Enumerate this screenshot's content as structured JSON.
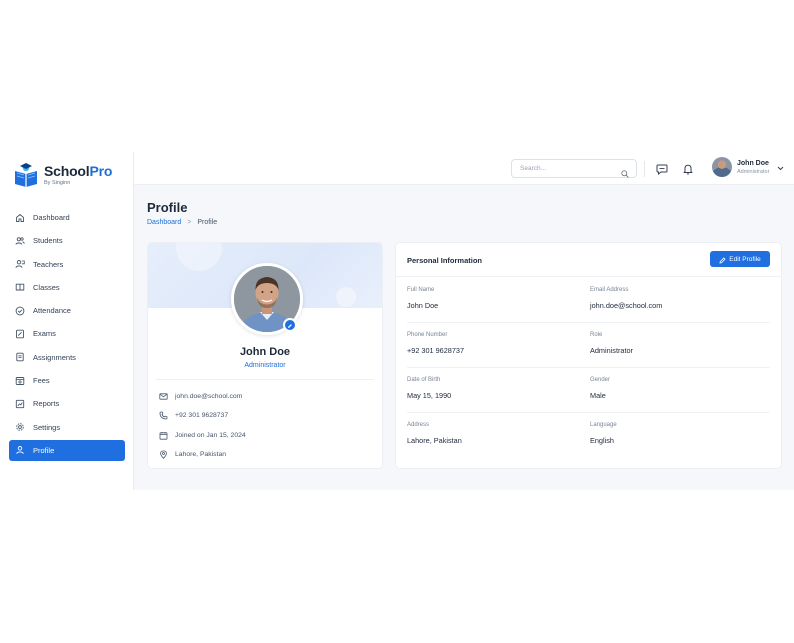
{
  "brand": {
    "name_main": "School",
    "name_accent": "Pro",
    "tagline": "By Singinn"
  },
  "sidebar": {
    "items": [
      {
        "label": "Dashboard",
        "icon": "home-icon"
      },
      {
        "label": "Students",
        "icon": "users-icon"
      },
      {
        "label": "Teachers",
        "icon": "teacher-icon"
      },
      {
        "label": "Classes",
        "icon": "classes-icon"
      },
      {
        "label": "Attendance",
        "icon": "check-circle-icon"
      },
      {
        "label": "Exams",
        "icon": "exam-icon"
      },
      {
        "label": "Assignments",
        "icon": "assignment-icon"
      },
      {
        "label": "Fees",
        "icon": "fees-icon"
      },
      {
        "label": "Reports",
        "icon": "reports-icon"
      },
      {
        "label": "Settings",
        "icon": "gear-icon"
      },
      {
        "label": "Profile",
        "icon": "user-icon",
        "active": true
      }
    ]
  },
  "topbar": {
    "search_placeholder": "Search...",
    "user": {
      "name": "John Doe",
      "role": "Administrator"
    }
  },
  "page": {
    "title": "Profile",
    "breadcrumb": {
      "parent": "Dashboard",
      "separator": ">",
      "current": "Profile"
    }
  },
  "profile_card": {
    "name": "John Doe",
    "role": "Administrator",
    "email": "john.doe@school.com",
    "phone": "+92 301 9628737",
    "joined": "Joined on Jan 15, 2024",
    "location": "Lahore, Pakistan"
  },
  "personal_info": {
    "title": "Personal Information",
    "edit_label": "Edit Profile",
    "fields": {
      "full_name": {
        "label": "Full Name",
        "value": "John Doe"
      },
      "email": {
        "label": "Email Address",
        "value": "john.doe@school.com"
      },
      "phone": {
        "label": "Phone Number",
        "value": "+92 301 9628737"
      },
      "role": {
        "label": "Role",
        "value": "Administrator"
      },
      "dob": {
        "label": "Date of Birth",
        "value": "May 15, 1990"
      },
      "gender": {
        "label": "Gender",
        "value": "Male"
      },
      "address": {
        "label": "Address",
        "value": "Lahore, Pakistan"
      },
      "language": {
        "label": "Language",
        "value": "English"
      }
    }
  },
  "colors": {
    "accent": "#1f6fe0",
    "text": "#1e293b",
    "muted": "#7a8494",
    "background": "#f5f7fa"
  }
}
